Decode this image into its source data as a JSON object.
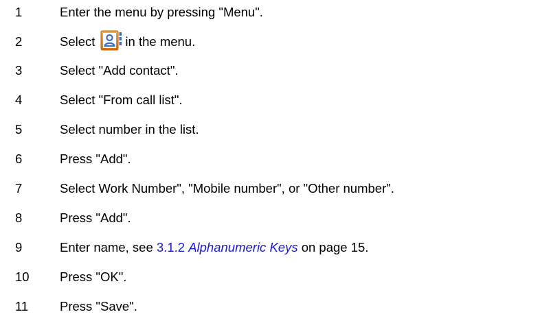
{
  "steps": [
    {
      "number": "1",
      "text": "Enter the menu by pressing \"Menu\"."
    },
    {
      "number": "2",
      "text_before": "Select",
      "icon": "contacts-icon",
      "text_after": "in the menu."
    },
    {
      "number": "3",
      "text": "Select \"Add contact\"."
    },
    {
      "number": "4",
      "text": "Select \"From call list\"."
    },
    {
      "number": "5",
      "text": "Select number in the list."
    },
    {
      "number": "6",
      "text": "Press \"Add\"."
    },
    {
      "number": "7",
      "text": "Select Work Number\", \"Mobile number\", or \"Other number\"."
    },
    {
      "number": "8",
      "text": "Press \"Add\"."
    },
    {
      "number": "9",
      "text_before": "Enter name, see",
      "link_section": "3.1.2",
      "link_title": "Alphanumeric Keys",
      "text_after": "on page 15."
    },
    {
      "number": "10",
      "text": "Press \"OK\"."
    },
    {
      "number": "11",
      "text": "Press \"Save\"."
    }
  ],
  "colors": {
    "text": "#000000",
    "link": "#1a1acc",
    "icon_accent": "#e8890c",
    "icon_figure": "#3a6fc4"
  }
}
